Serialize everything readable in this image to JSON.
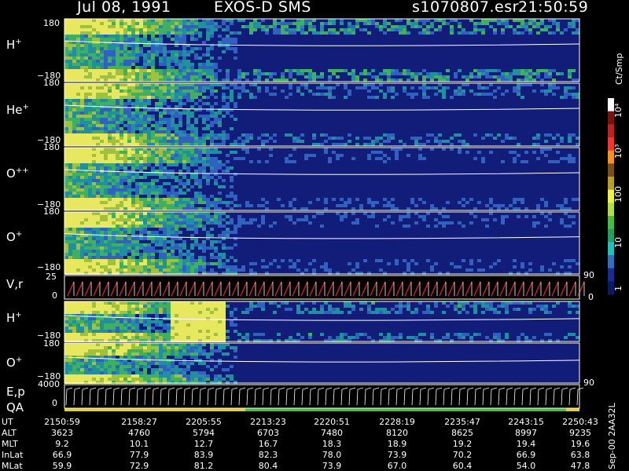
{
  "header": {
    "date": "Jul 08, 1991",
    "instrument": "EXOS-D SMS",
    "file": "s1070807.esr",
    "time": "21:50:59"
  },
  "panels": [
    {
      "label": "H",
      "sup": "+",
      "top_tick": "180",
      "bottom_tick": "−180"
    },
    {
      "label": "He",
      "sup": "+",
      "top_tick": "180",
      "bottom_tick": "−180"
    },
    {
      "label": "O",
      "sup": "++",
      "top_tick": "180",
      "bottom_tick": "−180"
    },
    {
      "label": "O",
      "sup": "+",
      "top_tick": "180",
      "bottom_tick": "−180"
    },
    {
      "label": "V,r",
      "sup": "",
      "top_tick": "25",
      "bottom_tick": "0",
      "right_top": "90",
      "right_bottom": "0"
    },
    {
      "label": "H",
      "sup": "+",
      "top_tick": "",
      "bottom_tick": "−180"
    },
    {
      "label": "O",
      "sup": "+",
      "top_tick": "180",
      "bottom_tick": "−180",
      "right_bottom": "90"
    },
    {
      "label": "E,p",
      "sup": "",
      "top_tick": "4000",
      "bottom_tick": "0"
    }
  ],
  "qa_label": "QA",
  "colorbar": {
    "unit": "Ct/Smp",
    "tick_labels": [
      "10⁴",
      "10³",
      "100",
      "10",
      "1"
    ],
    "colors": [
      "#ffffff",
      "#7a1010",
      "#c02020",
      "#ff3030",
      "#ff9020",
      "#7a5010",
      "#b8a020",
      "#f0f040",
      "#b0e040",
      "#40c040",
      "#20a060",
      "#20c0c0",
      "#3070c0",
      "#1a2a9a",
      "#0a1a6a"
    ]
  },
  "ephemeris": {
    "rows": [
      {
        "label": "UT",
        "values": [
          "2150:59",
          "2158:27",
          "2205:55",
          "2213:23",
          "2220:51",
          "2228:19",
          "2235:47",
          "2243:15",
          "2250:43"
        ]
      },
      {
        "label": "ALT",
        "values": [
          "3623",
          "4760",
          "5794",
          "6703",
          "7480",
          "8120",
          "8625",
          "8997",
          "9235"
        ]
      },
      {
        "label": "MLT",
        "values": [
          "9.2",
          "10.1",
          "12.7",
          "16.7",
          "18.3",
          "18.9",
          "19.2",
          "19.4",
          "19.6"
        ]
      },
      {
        "label": "InLat",
        "values": [
          "66.9",
          "77.9",
          "83.9",
          "82.3",
          "78.0",
          "73.9",
          "70.2",
          "66.9",
          "63.8"
        ]
      },
      {
        "label": "MLat",
        "values": [
          "59.9",
          "72.9",
          "81.2",
          "80.4",
          "73.9",
          "67.0",
          "60.4",
          "54.0",
          "47.8"
        ]
      }
    ]
  },
  "footer_note": "Sep-00 2AA32L",
  "chart_data": {
    "type": "heatmap",
    "title": "Jul 08, 1991 EXOS-D SMS",
    "x": [
      "2150:59",
      "2158:27",
      "2205:55",
      "2213:23",
      "2220:51",
      "2228:19",
      "2235:47",
      "2243:15",
      "2250:43"
    ],
    "panels": [
      "H+",
      "He+",
      "O++",
      "O+",
      "V,r",
      "H+",
      "O+",
      "E,p"
    ],
    "pitch_angle_range": [
      -180,
      180
    ],
    "color_scale": "log",
    "color_range": [
      1,
      10000
    ],
    "colorbar_label": "Ct/Smp"
  }
}
